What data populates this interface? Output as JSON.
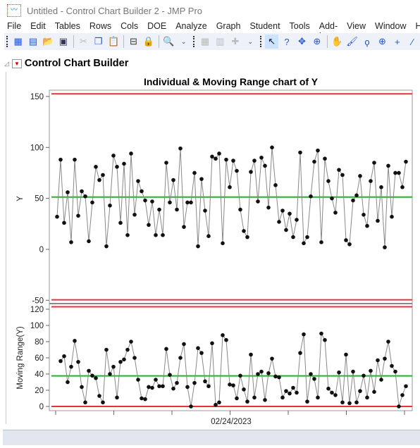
{
  "window": {
    "title": "Untitled - Control Chart Builder 2 - JMP Pro"
  },
  "menu": [
    "File",
    "Edit",
    "Tables",
    "Rows",
    "Cols",
    "DOE",
    "Analyze",
    "Graph",
    "Student",
    "Tools",
    "Add-Ins",
    "View",
    "Window",
    "H"
  ],
  "report": {
    "title": "Control Chart Builder"
  },
  "colors": {
    "limit": "#e8313f",
    "center": "#22b32e",
    "line": "#888888",
    "point": "#111111"
  },
  "chart_data": [
    {
      "type": "line",
      "title": "Individual & Moving Range chart of Y",
      "ylabel": "Y",
      "ylim": [
        -52,
        155
      ],
      "yticks": [
        "150",
        "100",
        "50",
        "0",
        "-50"
      ],
      "ytick_values": [
        150,
        100,
        50,
        0,
        -50
      ],
      "ucl": 152.6,
      "center": 51.3,
      "lcl": -49.5,
      "values": [
        32,
        88,
        26,
        56,
        7,
        88,
        33,
        57,
        52,
        8,
        46,
        81,
        68,
        73,
        3,
        43,
        92,
        81,
        26,
        84,
        14,
        94,
        34,
        67,
        57,
        48,
        24,
        47,
        14,
        39,
        14,
        85,
        46,
        68,
        39,
        99,
        22,
        46,
        46,
        75,
        3,
        69,
        38,
        13,
        91,
        89,
        94,
        6,
        88,
        61,
        87,
        77,
        39,
        18,
        12,
        76,
        87,
        47,
        90,
        82,
        41,
        100,
        63,
        27,
        38,
        19,
        35,
        12,
        29,
        95,
        6,
        12,
        52,
        86,
        97,
        7,
        89,
        67,
        50,
        36,
        78,
        73,
        9,
        5,
        48,
        53,
        72,
        34,
        23,
        67,
        85,
        28,
        61,
        2,
        82,
        32,
        75,
        75,
        61,
        86
      ]
    },
    {
      "type": "line",
      "ylabel": "Moving Range(Y)",
      "ylim": [
        -3,
        125
      ],
      "yticks": [
        "120",
        "100",
        "80",
        "60",
        "40",
        "20",
        "0"
      ],
      "ytick_values": [
        120,
        100,
        80,
        60,
        40,
        20,
        0
      ],
      "ucl": 123,
      "center": 37.7,
      "lcl": 0,
      "xtick_label": "02/24/2023"
    }
  ]
}
